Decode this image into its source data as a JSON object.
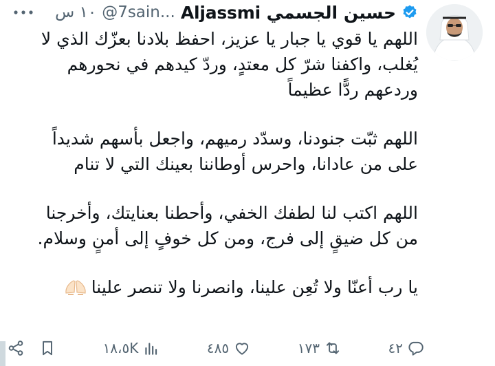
{
  "author": {
    "name": "حسين الجسمي Aljassmi",
    "handle": "@7sain...",
    "time": "١٠ س",
    "verified": true,
    "avatar_icon": "profile-photo"
  },
  "post": {
    "paragraphs": [
      "اللهم يا قوي يا جبار يا عزيز، احفظ بلادنا بعزّك الذي لا\nيُغلب، واكفنا شرّ كل معتدٍ، وردّ كيدهم في نحورهم\nوردعهم ردًّا عظيماً",
      "اللهم ثبّت جنودنا، وسدّد رميهم، واجعل بأسهم شديداً\nعلى من عادانا، واحرس أوطاننا بعينك التي لا تنام",
      "اللهم اكتب لنا لطفك الخفي، وأحطنا بعنايتك، وأخرجنا\nمن كل ضيقٍ إلى فرج، ومن كل خوفٍ إلى أمنٍ وسلام.",
      "يا رب أعنّا ولا تُعِن علينا، وانصرنا ولا تنصر علينا"
    ],
    "trailing_emoji": "praying-hands-emoji"
  },
  "actions": {
    "replies": "٤٢",
    "reposts": "١٧٣",
    "likes": "٤٨٥",
    "views": "١٨،٥K"
  },
  "colors": {
    "text": "#0f1419",
    "secondary": "#536471",
    "verified": "#1d9bf0"
  }
}
